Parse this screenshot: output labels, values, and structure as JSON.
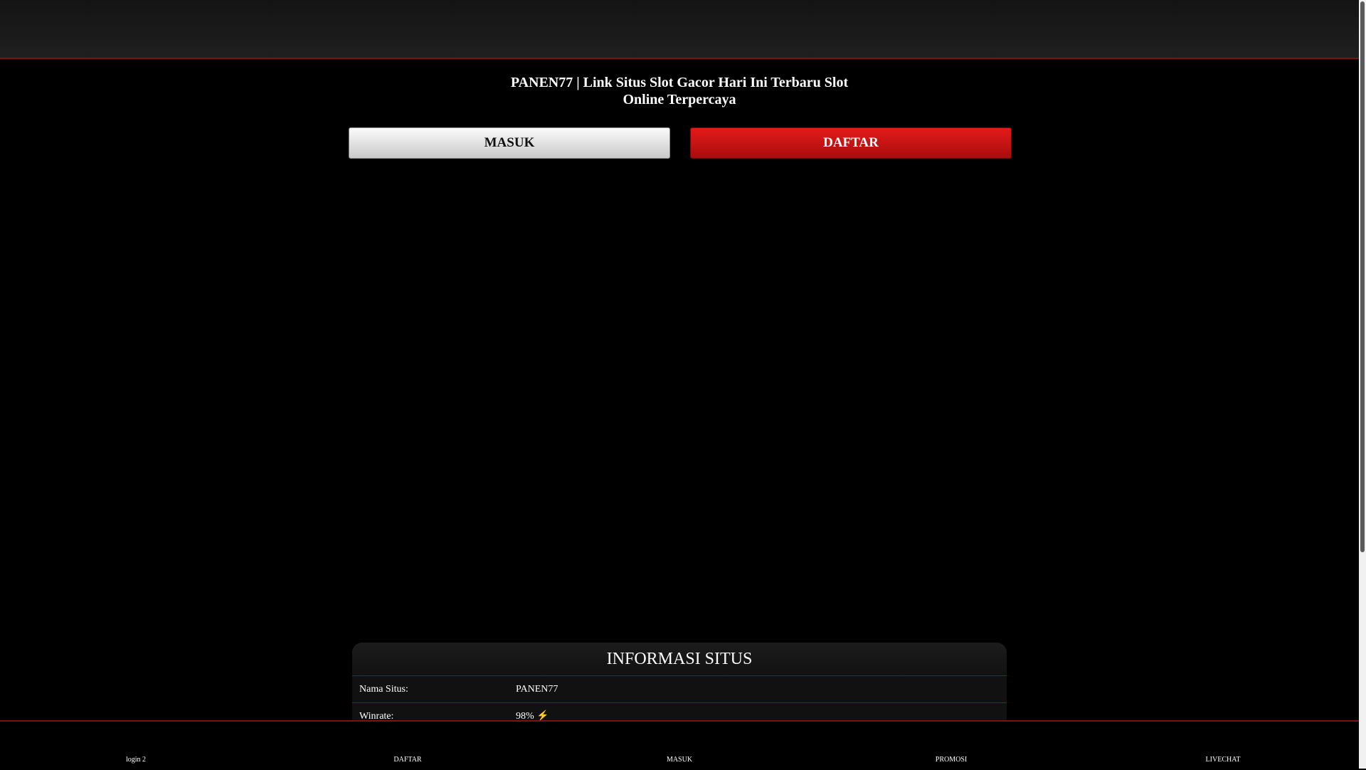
{
  "header": {
    "title": "PANEN77 | Link Situs Slot Gacor Hari Ini Terbaru Slot Online Terpercaya"
  },
  "buttons": {
    "masuk": "MASUK",
    "daftar": "DAFTAR"
  },
  "info": {
    "heading": "INFORMASI SITUS",
    "rows": [
      {
        "label": "Nama Situs:",
        "value": "PANEN77"
      },
      {
        "label": "Winrate:",
        "value": "98% ⚡"
      }
    ]
  },
  "bottom_nav": [
    {
      "label": "login 2"
    },
    {
      "label": "DAFTAR"
    },
    {
      "label": "MASUK"
    },
    {
      "label": "PROMOSI"
    },
    {
      "label": "LIVECHAT"
    }
  ],
  "colors": {
    "accent_red": "#e41a1a",
    "border_red": "#7a1414",
    "background": "#000000"
  }
}
